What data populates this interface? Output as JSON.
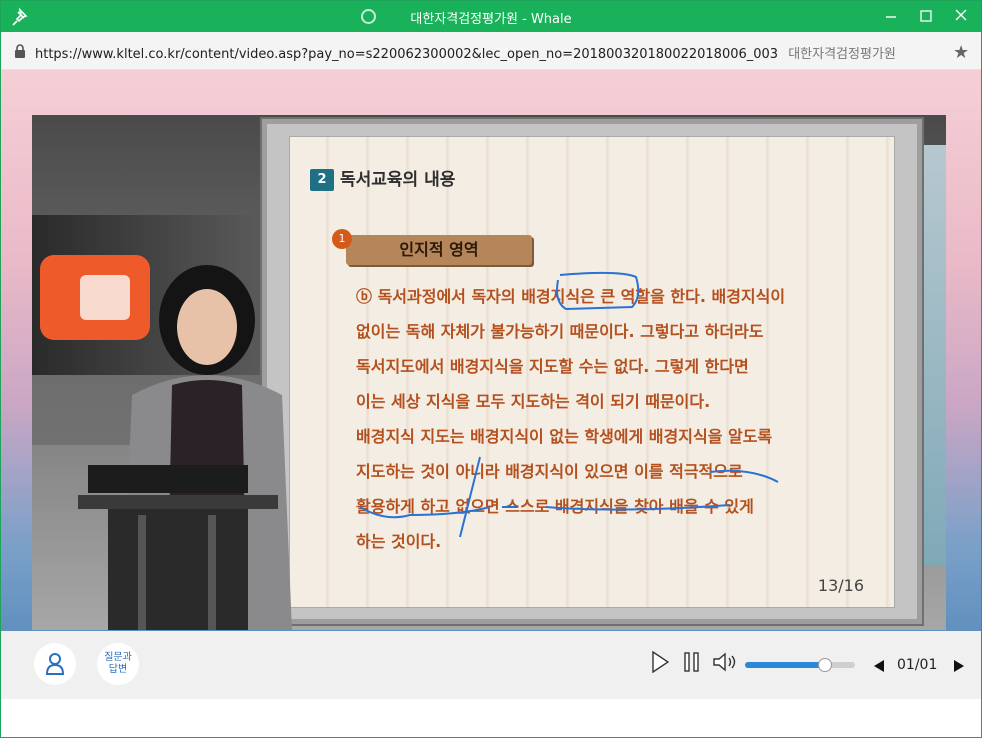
{
  "window": {
    "title": "대한자격검정평가원 - Whale",
    "accent_color": "#19b25a"
  },
  "address_bar": {
    "url": "https://www.kltel.co.kr/content/video.asp?pay_no=s220062300002&lec_open_no=20180032018002201​8006_003",
    "page_title": "대한자격검정평가원"
  },
  "lecture": {
    "section_number": "2",
    "section_title": "독서교육의 내용",
    "subsection_number": "1",
    "subsection_title": "인지적 영역",
    "lines": [
      "ⓑ 독서과정에서 독자의 배경지식은 큰 역할을 한다. 배경지식이",
      "없이는 독해 자체가 불가능하기 때문이다. 그렇다고 하더라도",
      "독서지도에서 배경지식을 지도할 수는 없다. 그렇게 한다면",
      "이는 세상 지식을 모두 지도하는 격이 되기 때문이다.",
      "배경지식 지도는 배경지식이 없는 학생에게 배경지식을 알도록",
      "지도하는 것이 아니라 배경지식이 있으면 이를 적극적으로",
      "활용하게 하고 없으면 스스로 배경지식을 찾아 배울 수 있게",
      "하는 것이다."
    ],
    "page": "13/16"
  },
  "controls": {
    "profile_icon": "person-icon",
    "qa_label": "질문과\n답변",
    "play_icon": "play-icon",
    "pause_icon": "pause-icon",
    "volume_icon": "volume-icon",
    "volume_level_percent": 73,
    "prev_icon": "prev-icon",
    "next_icon": "next-icon",
    "page_indicator": "01/01"
  }
}
